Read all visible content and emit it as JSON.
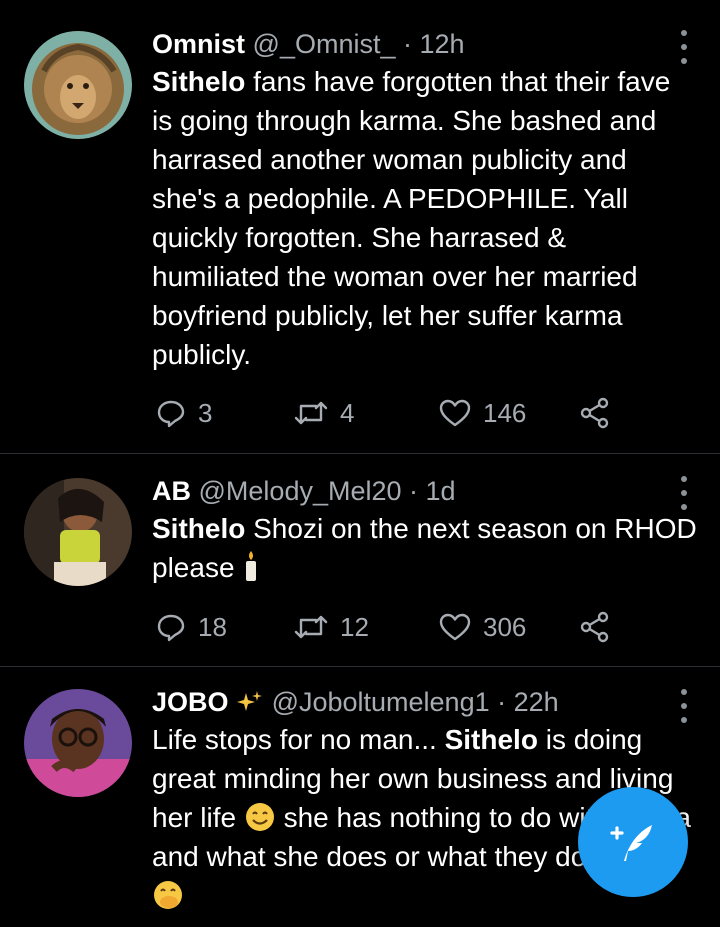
{
  "tweets": [
    {
      "name": "Omnist",
      "handle": "@_Omnist_",
      "sep": " · ",
      "time": "12h",
      "text_bold": "Sithelo",
      "text_rest": " fans have forgotten that their fave is going through karma. She bashed and harrased another woman publicity and she's a pedophile. A PEDOPHILE. Yall quickly forgotten. She harrased & humiliated the woman over her married boyfriend publicly, let her suffer karma publicly.",
      "replies": "3",
      "retweets": "4",
      "likes": "146"
    },
    {
      "name": "AB",
      "handle": "@Melody_Mel20",
      "sep": " · ",
      "time": "1d",
      "text_bold": "Sithelo",
      "text_rest": " Shozi on the next season on RHOD please ",
      "replies": "18",
      "retweets": "12",
      "likes": "306"
    },
    {
      "name": "JOBO",
      "handle": "@Joboltumeleng1",
      "sep": " · ",
      "time": "22h",
      "text_pre": "Life stops for no man... ",
      "text_bold": "Sithelo",
      "text_mid": " is doing great minding her own business and living her life ",
      "text_mid2": " she has nothing to do with Tamia and what she does or what they do for her "
    }
  ],
  "icons": {
    "more": "more-vertical-icon",
    "reply": "reply-icon",
    "retweet": "retweet-icon",
    "like": "heart-icon",
    "share": "share-icon",
    "compose": "compose-tweet-icon"
  },
  "colors": {
    "background": "#000000",
    "text": "#ffffff",
    "secondary": "#a6acb2",
    "accent": "#1d9bf0"
  }
}
